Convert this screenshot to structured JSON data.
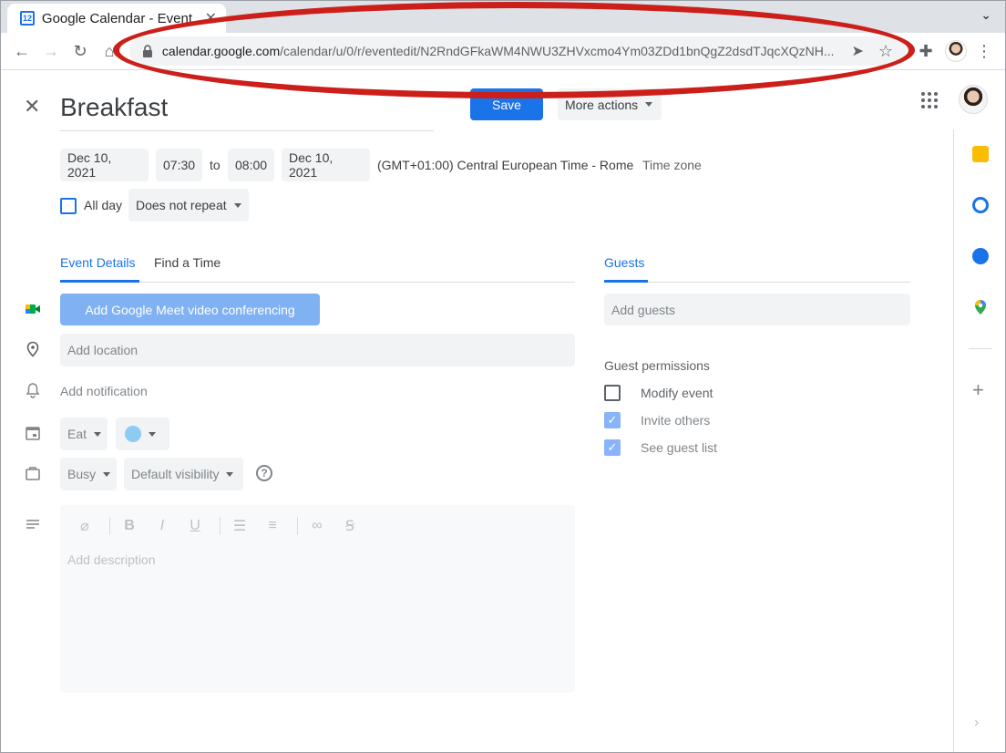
{
  "browser": {
    "tab_title": "Google Calendar - Event",
    "url_host": "calendar.google.com",
    "url_path": "/calendar/u/0/r/eventedit/N2RndGFkaWM4NWU3ZHVxcmo4Ym03ZDd1bnQgZ2dsdTJqcXQzNH..."
  },
  "event": {
    "title": "Breakfast",
    "save_label": "Save",
    "more_actions_label": "More actions",
    "start_date": "Dec 10, 2021",
    "start_time": "07:30",
    "to_label": "to",
    "end_time": "08:00",
    "end_date": "Dec 10, 2021",
    "timezone_text": "(GMT+01:00) Central European Time - Rome",
    "timezone_link": "Time zone",
    "allday_label": "All day",
    "repeat_value": "Does not repeat"
  },
  "details": {
    "tab_event_details": "Event Details",
    "tab_find_time": "Find a Time",
    "meet_button": "Add Google Meet video conferencing",
    "location_placeholder": "Add location",
    "add_notification": "Add notification",
    "calendar_value": "Eat",
    "busy_value": "Busy",
    "visibility_value": "Default visibility",
    "description_placeholder": "Add description"
  },
  "guests": {
    "tab_label": "Guests",
    "add_placeholder": "Add guests",
    "permissions_title": "Guest permissions",
    "perm_modify": "Modify event",
    "perm_invite": "Invite others",
    "perm_see_list": "See guest list"
  },
  "colors": {
    "accent": "#1a73e8",
    "annotation": "#cc1f1a"
  }
}
